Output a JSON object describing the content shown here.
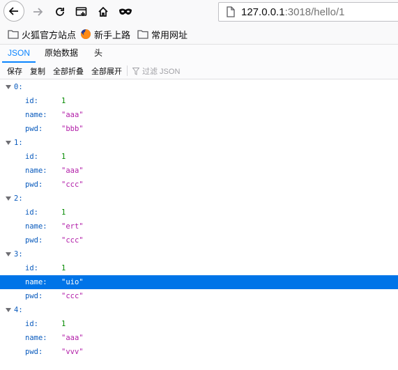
{
  "browser": {
    "url_host": "127.0.0.1",
    "url_rest": ":3018/hello/1"
  },
  "bookmarks": [
    {
      "label": "火狐官方站点",
      "icon": "folder-icon"
    },
    {
      "label": "新手上路",
      "icon": "firefox-icon"
    },
    {
      "label": "常用网址",
      "icon": "folder-icon"
    }
  ],
  "viewer_tabs": [
    {
      "label": "JSON",
      "active": true
    },
    {
      "label": "原始数据",
      "active": false
    },
    {
      "label": "头",
      "active": false
    }
  ],
  "actions": {
    "save": "保存",
    "copy": "复制",
    "collapse_all": "全部折叠",
    "expand_all": "全部展开",
    "filter_placeholder": "过滤 JSON"
  },
  "items": [
    {
      "index": "0:",
      "fields": [
        {
          "key": "id:",
          "value": "1",
          "type": "num"
        },
        {
          "key": "name:",
          "value": "\"aaa\"",
          "type": "str"
        },
        {
          "key": "pwd:",
          "value": "\"bbb\"",
          "type": "str"
        }
      ]
    },
    {
      "index": "1:",
      "fields": [
        {
          "key": "id:",
          "value": "1",
          "type": "num"
        },
        {
          "key": "name:",
          "value": "\"aaa\"",
          "type": "str"
        },
        {
          "key": "pwd:",
          "value": "\"ccc\"",
          "type": "str"
        }
      ]
    },
    {
      "index": "2:",
      "fields": [
        {
          "key": "id:",
          "value": "1",
          "type": "num"
        },
        {
          "key": "name:",
          "value": "\"ert\"",
          "type": "str"
        },
        {
          "key": "pwd:",
          "value": "\"ccc\"",
          "type": "str"
        }
      ]
    },
    {
      "index": "3:",
      "fields": [
        {
          "key": "id:",
          "value": "1",
          "type": "num"
        },
        {
          "key": "name:",
          "value": "\"uio\"",
          "type": "str",
          "selected": true
        },
        {
          "key": "pwd:",
          "value": "\"ccc\"",
          "type": "str"
        }
      ]
    },
    {
      "index": "4:",
      "fields": [
        {
          "key": "id:",
          "value": "1",
          "type": "num"
        },
        {
          "key": "name:",
          "value": "\"aaa\"",
          "type": "str"
        },
        {
          "key": "pwd:",
          "value": "\"vvv\"",
          "type": "str"
        }
      ]
    }
  ]
}
